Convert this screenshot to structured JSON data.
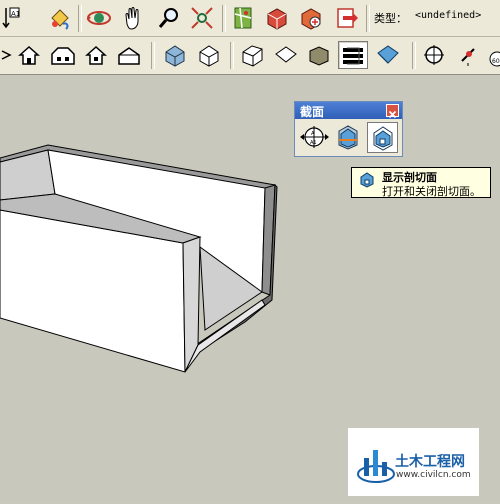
{
  "toolbar": {
    "type_label": "类型：",
    "type_value": "<undefined>",
    "buttons_row1": [
      {
        "name": "text-tool-icon",
        "tip": ""
      },
      {
        "name": "paint-bucket-icon",
        "tip": ""
      },
      {
        "name": "orbit-icon",
        "tip": ""
      },
      {
        "name": "pan-icon",
        "tip": ""
      },
      {
        "name": "zoom-icon",
        "tip": ""
      },
      {
        "name": "zoom-extents-icon",
        "tip": ""
      },
      {
        "name": "map-icon",
        "tip": ""
      },
      {
        "name": "component-warehouse-icon",
        "tip": ""
      },
      {
        "name": "share-model-icon",
        "tip": ""
      },
      {
        "name": "export-icon",
        "tip": ""
      }
    ],
    "buttons_row2": [
      {
        "name": "iso-view-icon"
      },
      {
        "name": "top-view-icon"
      },
      {
        "name": "front-view-icon"
      },
      {
        "name": "right-view-icon"
      },
      {
        "name": "back-view-icon"
      },
      {
        "name": "xray-icon"
      },
      {
        "name": "wireframe-icon"
      },
      {
        "name": "hidden-line-icon"
      },
      {
        "name": "shaded-icon"
      },
      {
        "name": "shaded-textures-icon",
        "pressed": true
      },
      {
        "name": "monochrome-icon"
      },
      {
        "name": "position-camera-icon"
      },
      {
        "name": "walk-icon"
      },
      {
        "name": "look-around-icon"
      }
    ]
  },
  "section_panel": {
    "title": "截面",
    "buttons": [
      {
        "name": "section-plane-tool-icon",
        "pressed": false
      },
      {
        "name": "display-section-planes-icon",
        "pressed": false
      },
      {
        "name": "display-section-cuts-icon",
        "pressed": true
      }
    ]
  },
  "tooltip": {
    "title": "显示剖切面",
    "description": "打开和关闭剖切面。"
  },
  "watermark": {
    "name": "土木工程网",
    "url": "www.civilcn.com"
  },
  "colors": {
    "viewport_bg": "#c8c8bd",
    "toolbar_bg": "#ece9d8",
    "title_bar": "#2f5fb8",
    "tooltip_bg": "#ffffe1",
    "watermark_blue": "#1a5fa8"
  }
}
